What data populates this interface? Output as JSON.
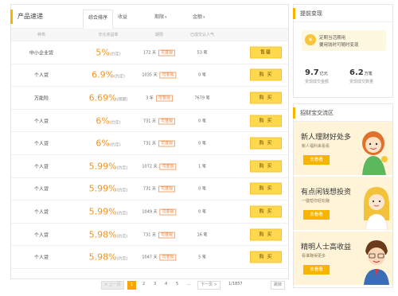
{
  "main": {
    "title": "产品速递",
    "tabs": [
      {
        "label": "综合排序"
      },
      {
        "label": "收益"
      },
      {
        "label": "期限"
      },
      {
        "label": "金额"
      }
    ],
    "columns": [
      "种类",
      "年化收益率",
      "期限",
      "已成交认人气"
    ],
    "rows": [
      {
        "type": "中小企业贷",
        "rate": "5%",
        "rate_tip": "(约定)",
        "term": "172 天",
        "badge": "可变现",
        "sold": "53 笔",
        "action": "售罄"
      },
      {
        "type": "个人贷",
        "rate": "6.9%",
        "rate_tip": "(约定)",
        "term": "1035 天",
        "badge": "可变现",
        "sold": "0 笔",
        "action": "购 买"
      },
      {
        "type": "万能险",
        "rate": "6.69%",
        "rate_tip": "(预期)",
        "term": "3 年",
        "badge": "可变现",
        "sold": "7679 笔",
        "action": "购 买"
      },
      {
        "type": "个人贷",
        "rate": "6%",
        "rate_tip": "(约定)",
        "term": "731 天",
        "badge": "可变现",
        "sold": "0 笔",
        "action": "购 买"
      },
      {
        "type": "个人贷",
        "rate": "6%",
        "rate_tip": "(约定)",
        "term": "731 天",
        "badge": "可变现",
        "sold": "0 笔",
        "action": "购 买"
      },
      {
        "type": "个人贷",
        "rate": "5.99%",
        "rate_tip": "(约定)",
        "term": "1072 天",
        "badge": "可变现",
        "sold": "1 笔",
        "action": "购 买"
      },
      {
        "type": "个人贷",
        "rate": "5.99%",
        "rate_tip": "(约定)",
        "term": "731 天",
        "badge": "可变现",
        "sold": "0 笔",
        "action": "购 买"
      },
      {
        "type": "个人贷",
        "rate": "5.99%",
        "rate_tip": "(约定)",
        "term": "1049 天",
        "badge": "可变现",
        "sold": "0 笔",
        "action": "购 买"
      },
      {
        "type": "个人贷",
        "rate": "5.98%",
        "rate_tip": "(约定)",
        "term": "731 天",
        "badge": "可变现",
        "sold": "16 笔",
        "action": "购 买"
      },
      {
        "type": "个人贷",
        "rate": "5.98%",
        "rate_tip": "(约定)",
        "term": "1047 天",
        "badge": "可变现",
        "sold": "5 笔",
        "action": "购 买"
      }
    ]
  },
  "pager": {
    "prev": "< 上一页",
    "pages": [
      "1",
      "2",
      "3",
      "4",
      "5",
      "..."
    ],
    "next": "下一页 >",
    "total": "1/1857",
    "jump": "跳转"
  },
  "withdraw": {
    "title": "提前变现",
    "hint_line1": "定期当活期用",
    "hint_line2": "要用钱时可随时变现",
    "coin_icon": "¥",
    "stat1_value": "9.7",
    "stat1_unit": "亿元",
    "stat1_label": "变现成交金额",
    "stat2_value": "6.2",
    "stat2_unit": "万笔",
    "stat2_label": "变现成交数量"
  },
  "exchange": {
    "title": "招财宝交流区",
    "promos": [
      {
        "title": "新人理财好处多",
        "sub": "新人福利来看看",
        "button": "去看看"
      },
      {
        "title": "有点闲钱想投资",
        "sub": "一键帮你轻松赚",
        "button": "去看看"
      },
      {
        "title": "精明人士高收益",
        "sub": "看谁赚得更多",
        "button": "去看看"
      }
    ]
  },
  "colors": {
    "accent": "#f7b500",
    "rate": "#f5921e",
    "buy_button": "#ffd84e"
  }
}
